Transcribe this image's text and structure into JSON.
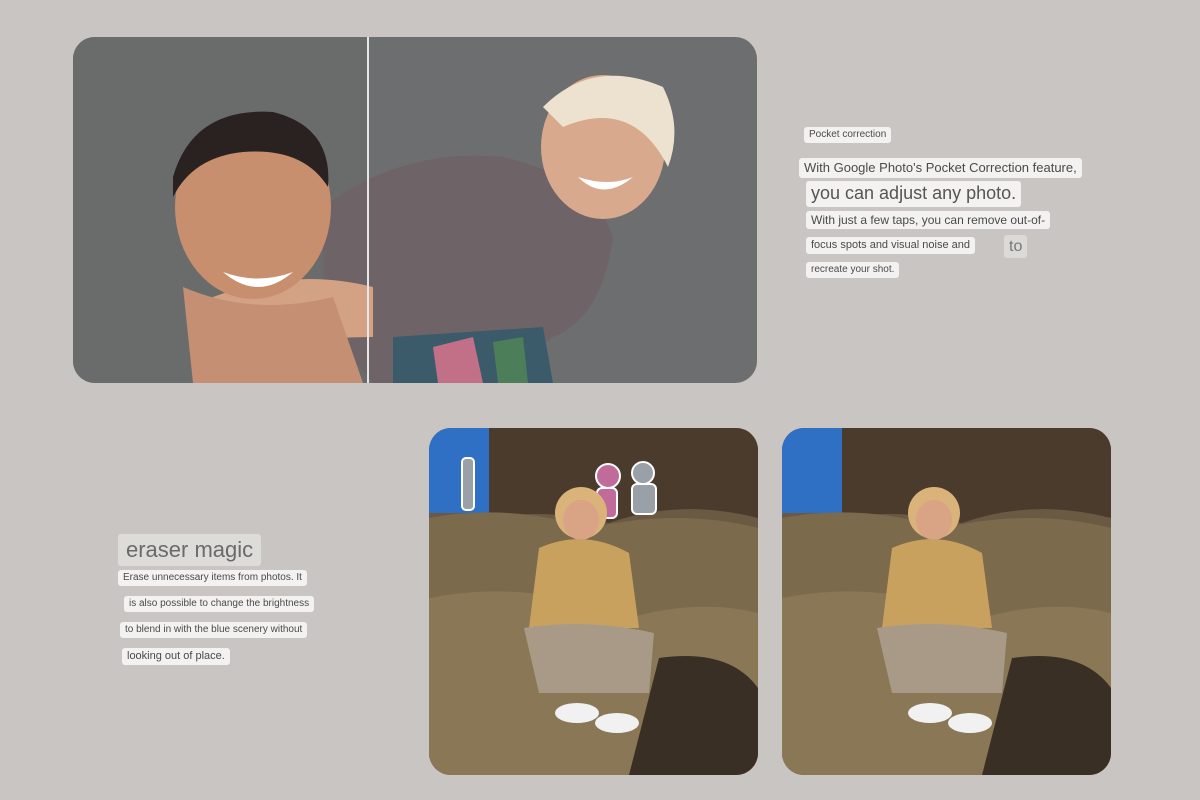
{
  "pocket_correction": {
    "label": "Pocket correction",
    "line1": "With Google Photo's Pocket Correction feature,",
    "line2": "you can adjust any photo.",
    "line3": "With just a few taps, you can remove out-of-",
    "line4": "focus spots and visual noise and",
    "line4_tail": "to",
    "line5": "recreate your shot."
  },
  "eraser_magic": {
    "title": "eraser magic",
    "line1": "Erase unnecessary items from photos. It",
    "line2": "is also possible to change the brightness",
    "line3": "to blend in with the blue scenery without",
    "line4": "looking out of place."
  },
  "images": {
    "top": "couple-piggyback-photo",
    "before": "eraser-before-photo",
    "after": "eraser-after-photo"
  },
  "colors": {
    "background": "#c8c5c2",
    "chip": "#f3f2f0",
    "sky": "#2f6fc4",
    "rock": "#6b5a43"
  }
}
